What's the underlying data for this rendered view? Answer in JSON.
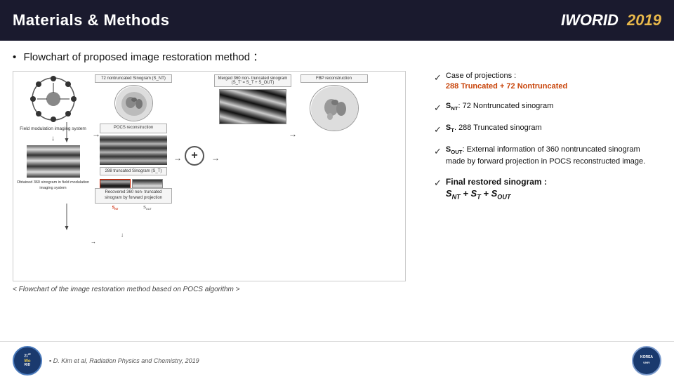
{
  "header": {
    "title": "Materials & Methods",
    "brand_name": "IWORID",
    "brand_year": "2019"
  },
  "content": {
    "bullet_heading": "Flowchart of proposed image restoration method ："
  },
  "annotations": {
    "item1_label": "Case of projections :",
    "item1_detail": "288 Truncated + 72 Nontruncated",
    "item2_label": "S",
    "item2_sub": "NT",
    "item2_detail": ": 72 Nontruncated sinogram",
    "item3_label": "S",
    "item3_sub": "T",
    "item3_detail": ". 288 Truncated sinogram",
    "item4_label": "S",
    "item4_sub": "OUT",
    "item4_detail": ": External information of 360 nontruncated sinogram made by forward projection in POCS reconstructed image.",
    "item5_label": "Final restored sinogram :",
    "item5_formula": "S",
    "item5_formula_nt": "NT",
    "item5_formula_plus1": "+",
    "item5_formula_st": "S",
    "item5_formula_t": "T",
    "item5_formula_plus2": "+",
    "item5_formula_sout": "S",
    "item5_formula_out": "OUT"
  },
  "caption": "< Flowchart of the image restoration method based on POCS algorithm >",
  "footer": {
    "logo_text": "21st\nWoRiD",
    "reference": "D. Kim et al, Radiation Physics and Chemistry, 2019"
  },
  "diagram": {
    "col1_label1": "Field modulation\nimaging system",
    "col1_label2": "Obtained 360 sinogram\nin field modulation\nimaging system",
    "col2_label1": "72 nontruncated\nSinogram (S_NT)",
    "col2_label2": "POCS\nreconstruction",
    "col2_label3": "288 truncated\nSinogram (S_T)",
    "col3_label": "Recovered 360 non-\ntruncated sinogram\nby forward projection",
    "col4_label": "Merged 360 non-\ntruncated sinogram\n(S_T' = S_T + S_OUT)",
    "col5_label": "FBP reconstruction"
  }
}
